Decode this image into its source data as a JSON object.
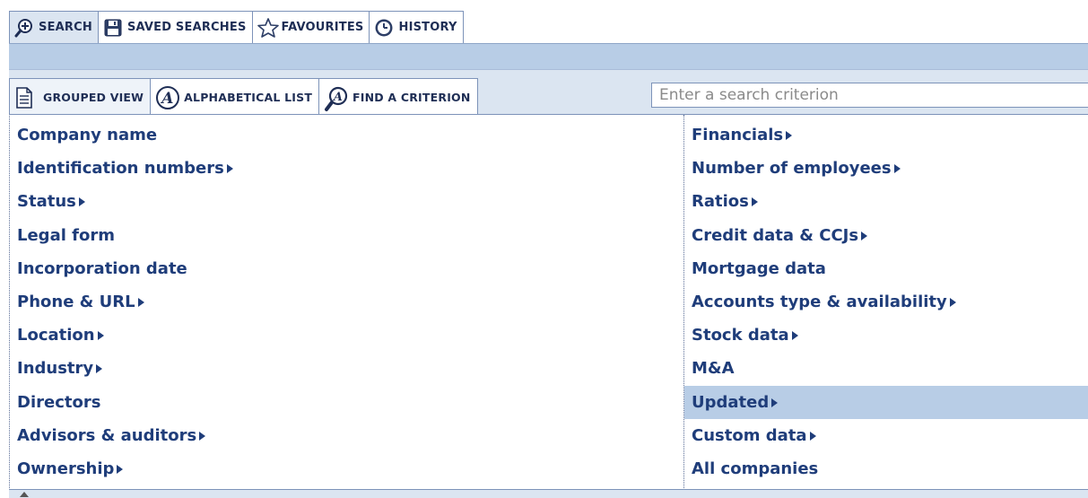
{
  "top_tabs": [
    {
      "label": "SEARCH",
      "icon": "magnifier-plus-icon",
      "active": true
    },
    {
      "label": "SAVED SEARCHES",
      "icon": "floppy-disk-icon",
      "active": false
    },
    {
      "label": "FAVOURITES",
      "icon": "star-icon",
      "active": false
    },
    {
      "label": "HISTORY",
      "icon": "clock-icon",
      "active": false
    }
  ],
  "view_tabs": [
    {
      "label": "GROUPED VIEW",
      "icon": "document-icon",
      "active": true
    },
    {
      "label": "ALPHABETICAL LIST",
      "icon": "letter-a-icon",
      "active": false
    },
    {
      "label": "FIND A CRITERION",
      "icon": "magnifier-a-icon",
      "active": false
    }
  ],
  "search": {
    "placeholder": "Enter a search criterion",
    "value": ""
  },
  "criteria": {
    "left": [
      {
        "label": "Company name",
        "submenu": false
      },
      {
        "label": "Identification numbers",
        "submenu": true
      },
      {
        "label": "Status",
        "submenu": true
      },
      {
        "label": "Legal form",
        "submenu": false
      },
      {
        "label": "Incorporation date",
        "submenu": false
      },
      {
        "label": "Phone & URL",
        "submenu": true
      },
      {
        "label": "Location",
        "submenu": true
      },
      {
        "label": "Industry",
        "submenu": true
      },
      {
        "label": "Directors",
        "submenu": false
      },
      {
        "label": "Advisors & auditors",
        "submenu": true
      },
      {
        "label": "Ownership",
        "submenu": true
      }
    ],
    "right": [
      {
        "label": "Financials",
        "submenu": true
      },
      {
        "label": "Number of employees",
        "submenu": true
      },
      {
        "label": "Ratios",
        "submenu": true
      },
      {
        "label": "Credit data & CCJs",
        "submenu": true
      },
      {
        "label": "Mortgage data",
        "submenu": false
      },
      {
        "label": "Accounts type & availability",
        "submenu": true
      },
      {
        "label": "Stock data",
        "submenu": true
      },
      {
        "label": "M&A",
        "submenu": false
      },
      {
        "label": "Updated",
        "submenu": true,
        "highlighted": true
      },
      {
        "label": "Custom data",
        "submenu": true
      },
      {
        "label": "All companies",
        "submenu": false
      }
    ]
  },
  "colors": {
    "link_text": "#1f3d7a",
    "tab_text": "#1f2e55",
    "band_blue": "#b8cde6",
    "light_blue": "#dbe5f1",
    "highlight": "#b8cde6",
    "border": "#7d93b9"
  }
}
